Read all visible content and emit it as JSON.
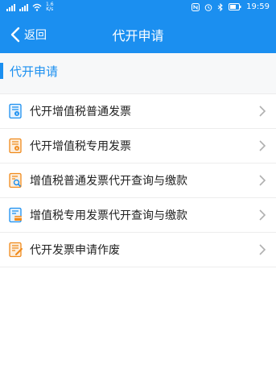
{
  "status_bar": {
    "net_speed_value": "1.6",
    "net_speed_unit": "K/s",
    "time": "19:59"
  },
  "nav": {
    "back_label": "返回",
    "title": "代开申请"
  },
  "section": {
    "title": "代开申请"
  },
  "menu": [
    {
      "label": "代开增值税普通发票",
      "icon": "invoice-general-icon",
      "color": "#1b8ff0"
    },
    {
      "label": "代开增值税专用发票",
      "icon": "invoice-special-icon",
      "color": "#f08a1b"
    },
    {
      "label": "增值税普通发票代开查询与缴款",
      "icon": "invoice-search-icon",
      "color": "#f08a1b"
    },
    {
      "label": "增值税专用发票代开查询与缴款",
      "icon": "invoice-payment-icon",
      "color": "#1b8ff0"
    },
    {
      "label": "代开发票申请作废",
      "icon": "invoice-void-icon",
      "color": "#f08a1b"
    }
  ],
  "colors": {
    "primary": "#1b8ff0",
    "accent": "#f08a1b",
    "text": "#222222",
    "divider": "#ededed"
  }
}
